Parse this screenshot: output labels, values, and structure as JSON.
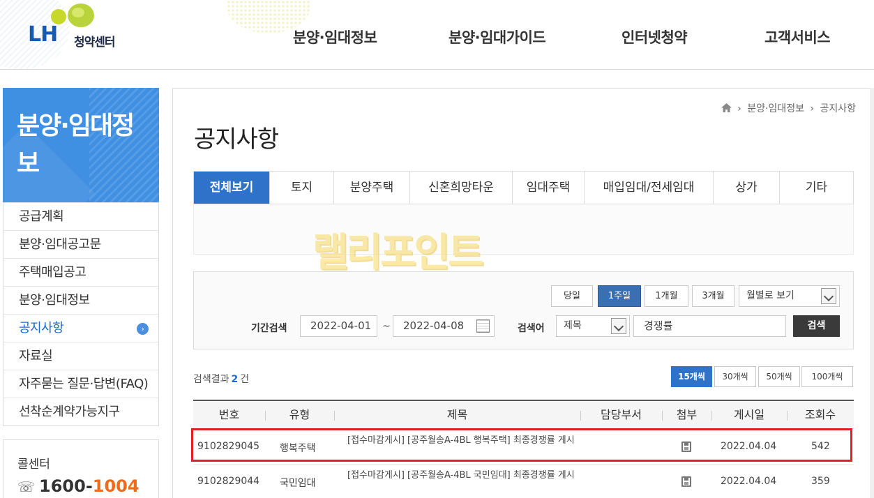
{
  "header": {
    "logo_text": "LH",
    "logo_sub": "청약센터",
    "nav": [
      "분양·임대정보",
      "분양·임대가이드",
      "인터넷청약",
      "고객서비스"
    ]
  },
  "sidebar": {
    "title": "분양·임대정보",
    "items": [
      {
        "label": "공급계획"
      },
      {
        "label": "분양·임대공고문"
      },
      {
        "label": "주택매입공고"
      },
      {
        "label": "분양·임대정보"
      },
      {
        "label": "공지사항",
        "active": true
      },
      {
        "label": "자료실"
      },
      {
        "label": "자주묻는 질문·답변(FAQ)"
      },
      {
        "label": "선착순계약가능지구"
      }
    ],
    "call_center": {
      "title": "콜센터",
      "number_part1": "1600-",
      "number_part2": "1004"
    }
  },
  "breadcrumb": [
    "분양·임대정보",
    "공지사항"
  ],
  "page_title": "공지사항",
  "tabs": [
    {
      "label": "전체보기",
      "active": true
    },
    {
      "label": "토지"
    },
    {
      "label": "분양주택"
    },
    {
      "label": "신혼희망타운"
    },
    {
      "label": "임대주택"
    },
    {
      "label": "매입임대/전세임대"
    },
    {
      "label": "상가"
    },
    {
      "label": "기타"
    }
  ],
  "watermark": "랠리포인트",
  "search": {
    "period_buttons": [
      {
        "label": "당일"
      },
      {
        "label": "1주일",
        "active": true
      },
      {
        "label": "1개월"
      },
      {
        "label": "3개월"
      }
    ],
    "month_select": "월별로 보기",
    "period_label": "기간검색",
    "date_from": "2022-04-01",
    "date_tilde": "~",
    "date_to": "2022-04-08",
    "keyword_label": "검색어",
    "keyword_type": "제목",
    "keyword_value": "경쟁률",
    "submit_label": "검색"
  },
  "results": {
    "label": "검색결과",
    "count": "2",
    "unit": "건",
    "per_page": [
      {
        "label": "15개씩",
        "active": true
      },
      {
        "label": "30개씩"
      },
      {
        "label": "50개씩"
      },
      {
        "label": "100개씩"
      }
    ]
  },
  "table": {
    "headers": [
      "번호",
      "유형",
      "제목",
      "담당부서",
      "첨부",
      "게시일",
      "조회수"
    ],
    "rows": [
      {
        "no": "9102829045",
        "type": "행복주택",
        "title": "[접수마감게시] [공주월송A-4BL 행복주택] 최종경쟁률 게시",
        "dept": "",
        "date": "2022.04.04",
        "views": "542"
      },
      {
        "no": "9102829044",
        "type": "국민임대",
        "title": "[접수마감게시] [공주월송A-4BL 국민임대] 최종경쟁률 게시",
        "dept": "",
        "date": "2022.04.04",
        "views": "359"
      }
    ]
  },
  "colors": {
    "brand_blue": "#1559b5",
    "tab_active": "#2f72c9",
    "highlight_red": "#e31e24",
    "call_orange": "#ef6b1b"
  }
}
